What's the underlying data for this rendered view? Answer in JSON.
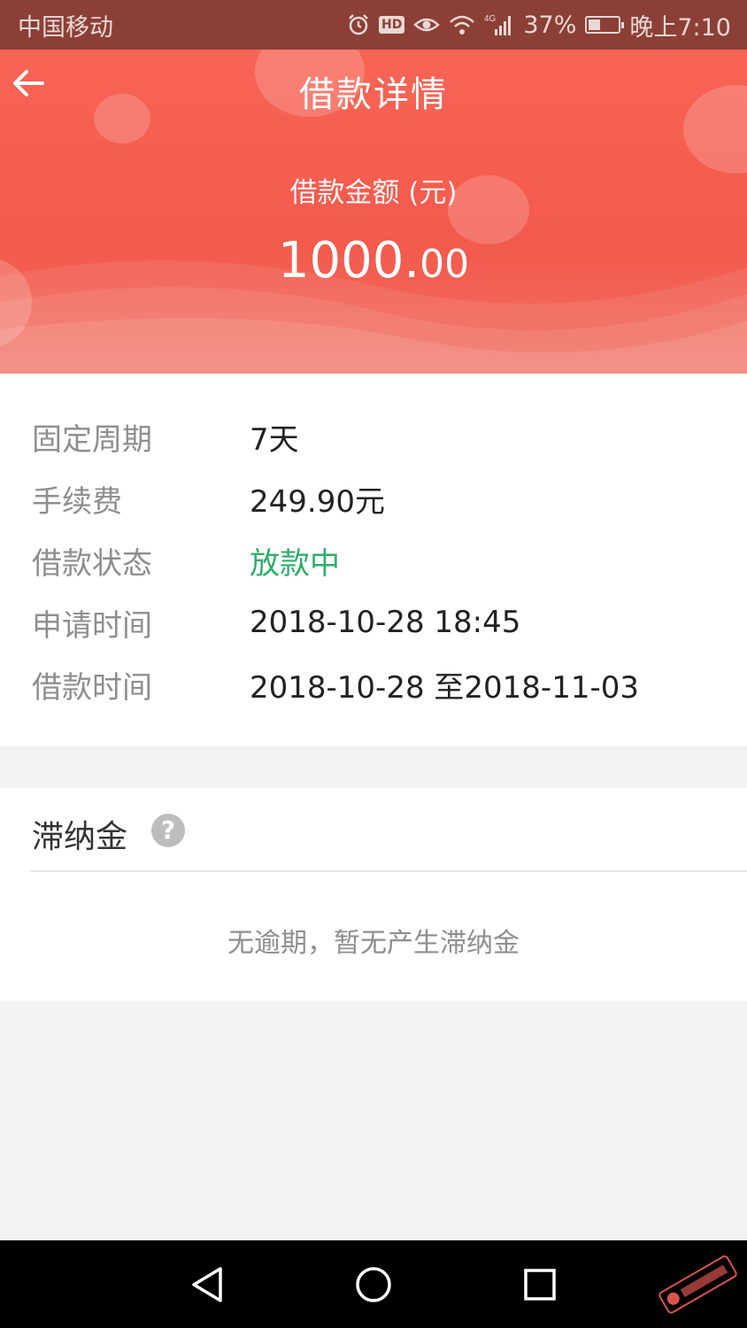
{
  "status_bar": {
    "carrier": "中国移动",
    "network": "4G",
    "battery": "37%",
    "time": "晚上7:10"
  },
  "header": {
    "title": "借款详情",
    "amount_label": "借款金额 (元)",
    "amount_int": "1000.",
    "amount_dec": "00",
    "accent_color": "#f25a4c"
  },
  "details": [
    {
      "key": "固定周期",
      "value": "7天"
    },
    {
      "key": "手续费",
      "value": "249.90元"
    },
    {
      "key": "借款状态",
      "value": "放款中",
      "status_color": "#2eae6b"
    },
    {
      "key": "申请时间",
      "value": "2018-10-28 18:45"
    },
    {
      "key": "借款时间",
      "value": "2018-10-28 至2018-11-03"
    }
  ],
  "late_fee": {
    "title": "滞纳金",
    "help_glyph": "?",
    "empty_text": "无逾期，暂无产生滞纳金"
  },
  "nav": {
    "icons": [
      "back-triangle-icon",
      "home-circle-icon",
      "recent-square-icon"
    ]
  }
}
